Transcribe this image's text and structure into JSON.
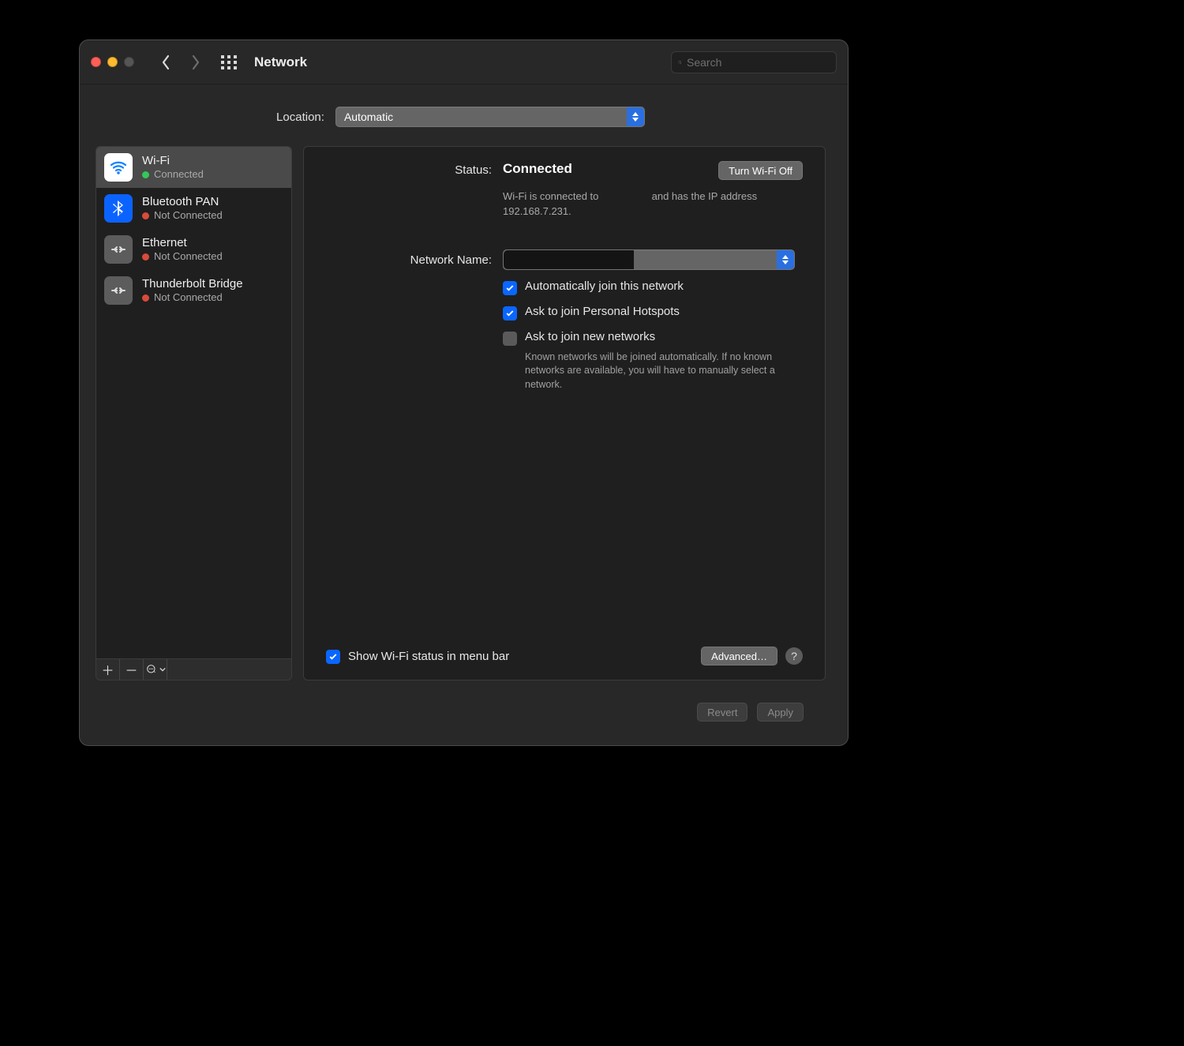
{
  "window": {
    "title": "Network",
    "search_placeholder": "Search"
  },
  "location": {
    "label": "Location:",
    "value": "Automatic"
  },
  "sidebar": {
    "items": [
      {
        "name": "Wi-Fi",
        "status": "Connected",
        "color": "green",
        "icon": "wifi",
        "selected": true
      },
      {
        "name": "Bluetooth PAN",
        "status": "Not Connected",
        "color": "red",
        "icon": "bluetooth"
      },
      {
        "name": "Ethernet",
        "status": "Not Connected",
        "color": "red",
        "icon": "ethernet"
      },
      {
        "name": "Thunderbolt Bridge",
        "status": "Not Connected",
        "color": "red",
        "icon": "ethernet"
      }
    ]
  },
  "detail": {
    "status_label": "Status:",
    "status_value": "Connected",
    "status_button": "Turn Wi-Fi Off",
    "status_explain_a": "Wi-Fi is connected to ",
    "status_explain_b": " and has the IP address 192.168.7.231.",
    "network_name_label": "Network Name:",
    "auto_join": "Automatically join this network",
    "ask_hotspot": "Ask to join Personal Hotspots",
    "ask_new": "Ask to join new networks",
    "ask_new_help": "Known networks will be joined automatically. If no known networks are available, you will have to manually select a network.",
    "show_status_menu": "Show Wi-Fi status in menu bar",
    "advanced": "Advanced…",
    "help": "?"
  },
  "footer": {
    "revert": "Revert",
    "apply": "Apply"
  }
}
